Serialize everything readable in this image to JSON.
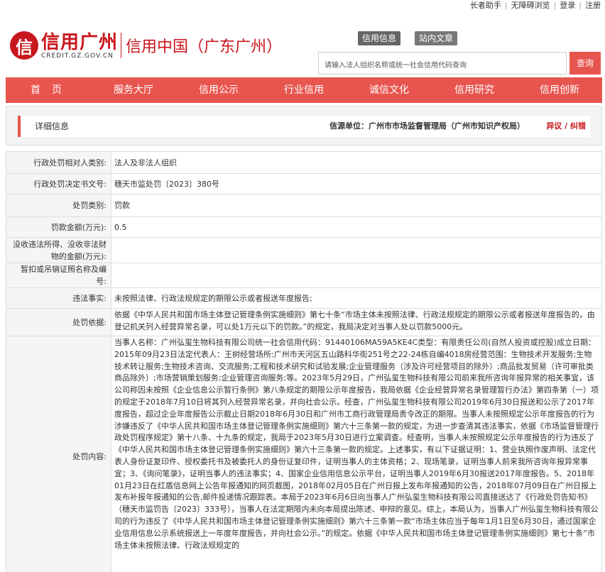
{
  "toplinks": [
    "长者助手",
    "无障碍浏览",
    "登录",
    "注册"
  ],
  "brand": {
    "mark": "信",
    "name": "信用广州",
    "domain": "CREDIT.GZ.GOV.CN",
    "sub": "信用中国（广东广州）"
  },
  "search": {
    "tabs": [
      "信用信息",
      "站内文章"
    ],
    "placeholder": "请输入法人组织名称或统一社会信用代码查询",
    "button": "查询"
  },
  "nav": [
    "首页",
    "服务大厅",
    "信用公示",
    "行业信用",
    "诚信文化",
    "信用研究",
    "信用创新"
  ],
  "panel": {
    "title": "详细信息",
    "source": "信源单位：广州市市场监督管理局（广州市知识产权局）",
    "error": "异议 / 纠错"
  },
  "colors": {
    "accent": "#e8554f",
    "brand": "#c8161d"
  },
  "rows": [
    {
      "label": "行政处罚相对人类别:",
      "value": "法人及非法人组织"
    },
    {
      "label": "行政处罚决定书文号:",
      "value": "穗天市监处罚〔2023〕380号"
    },
    {
      "label": "处罚类别:",
      "value": "罚款"
    },
    {
      "label": "罚款金额(万元):",
      "value": "0.5"
    },
    {
      "label": "没收违法所得、没收非法财物的金额(万元):",
      "value": ""
    },
    {
      "label": "暂扣或吊销证照名称及编号:",
      "value": ""
    },
    {
      "label": "违法事实:",
      "value": "未按照法律、行政法规规定的期限公示或者报送年度报告;"
    },
    {
      "label": "处罚依据:",
      "value": "依据《中华人民共和国市场主体登记管理条例实施细则》第七十条“市场主体未按照法律、行政法规规定的期限公示或者报送年度报告的，由登记机关列入经营异常名录，可以处1万元以下的罚款。”的规定，我局决定对当事人处以罚款5000元。"
    },
    {
      "label": "处罚内容:",
      "value": "当事人名称：广州弘玺生物科技有限公司统一社会信用代码：91440106MA59A5KE4C类型：有限责任公司(自然人投资或控股)成立日期：2015年09月23日法定代表人：王树经营场所:广州市天河区五山路科华街251号之22-24栋自编4018房经营范围：生物技术开发服务;生物技术转让服务;生物技术咨询、交流服务;工程和技术研究和试验发展;企业管理服务（涉及许可经营项目的除外）;商品批发贸易（许可审批类商品除外）;市场营销策划服务;企业管理咨询服务;等。2023年5月29日，广州弘玺生物科技有限公司前来我所咨询年报异常的相关事宜，该公司称因未按照《企业信息公示暂行条例》第八条规定的期限公示年度报告，我局依据《企业经营异常名录管理暂行办法》第四条第（一）项的规定于2018年7月10日将其列入经营异常名录，并向社会公示。经查，广州弘玺生物科技有限公司2019年6月30日报送和公示了2017年度报告，超过企业年度报告公示截止日期2018年6月30日和广州市工商行政管理局责令改正的期限。当事人未按照规定公示年度报告的行为涉嫌违反了《中华人民共和国市场主体登记管理条例实施细则》第六十三条第一款的规定，为进一步查清其违法事实，依据《市场监督管理行政处罚程序规定》第十八条、十九条的规定，我局于2023年5月30日进行立案调查。经查明，当事人未按照规定公示年度报告的行为违反了《中华人民共和国市场主体登记管理条例实施细则》第六十三条第一款的规定。上述事实，有以下证据证明：1、营业执照作废声明、法定代表人身份证复印件、授权委托书及被委托人的身份证复印件，证明当事人的主体资格；2、现场笔录，证明当事人前来我所咨询年报异常事宜；3、《询问笔录》，证明当事人的违法事实；4、国家企业信用信息公示平台，证明当事人2019年6月30报送2017年度报告。5、2018年01月23日在红盾信息网上公告年报通知的网页截图，2018年02月05日在广州日报上发布年报通知的公告，2018年07月09日在广州日报上发布补报年报通知的公告,邮件投递情况跟踪表。本局于2023年6月6日向当事人广州弘玺生物科技有限公司直接送达了《行政处罚告知书》（穗天市监罚告〔2023〕333号），当事人在法定期限内未向本局提出陈述、申辩的意见。综上，本局认为，当事人广州弘玺生物科技有限公司的行为违反了《中华人民共和国市场主体登记管理条例实施细则》第六十三条第一款“市场主体应当于每年1月1日至6月30日，通过国家企业信用信息公示系统报送上一年度年度报告，并向社会公示。”的规定。依据《中华人民共和国市场主体登记管理条例实施细则》第七十条“市场主体未按照法律、行政法规规定的"
    }
  ]
}
